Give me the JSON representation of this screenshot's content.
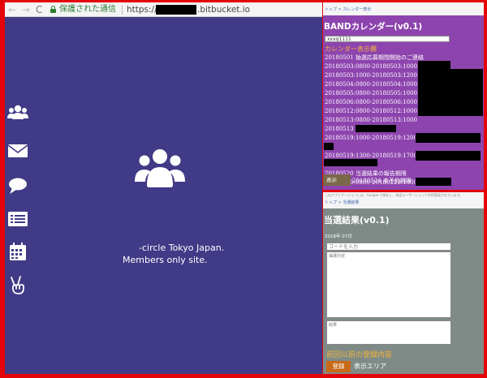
{
  "browser": {
    "back_icon": "←",
    "forward_icon": "→",
    "reload_icon": "C",
    "secure_label": "保護された通信",
    "url_prefix": "https://",
    "url_suffix": ".bitbucket.io"
  },
  "sidebar": {
    "icons": [
      "users-icon",
      "envelope-icon",
      "comment-icon",
      "list-icon",
      "calendar-icon",
      "peace-hand-icon"
    ]
  },
  "brand": {
    "icon": "users-icon",
    "tagline_line1": "-circle Tokyo Japan.",
    "tagline_line2": "Members only site."
  },
  "calendar_panel": {
    "breadcrumb": "トップ > カレンダー表示",
    "title": "BANDカレンダー(v0.1)",
    "input_value": "xxxg1111",
    "section_title": "カレンダー表示欄",
    "rows": [
      "20180501 抽選応募期間開始のご連絡",
      "20180503:0800-20180503:1000",
      "20180503:1000-20180503:1200",
      "20180504:0800-20180504:1000",
      "20180505:0800-20180505:1000",
      "20180506:0800-20180506:1000",
      "20180512:0800-20180512:1000",
      "20180513:0800-20180513:1000",
      "20180513",
      "20180519:1000-20180519:1200",
      "",
      "20180519:1300-20180519:1700",
      "",
      "20180520 当選結果の報告期限",
      "20180520:0800-20180520:1000",
      "20180524 本予約期限",
      "20180526:1200-20180526:1400"
    ],
    "button_label": "表示"
  },
  "result_panel": {
    "top_note": "このアプリケーションには、Google で保存し、承認ユーザーによって利用登録されています。",
    "breadcrumb": "トップ > 当選結果",
    "title": "当選結果(v0.1)",
    "date_label": "2018年 07月",
    "code_placeholder": "コードを入力",
    "draw_label": "抽選内容",
    "result_label": "結果",
    "prev_title": "前回以前の登録内容",
    "register_button": "登録",
    "area_label": "表示エリア"
  },
  "colors": {
    "frame": "#e4050a",
    "left_bg": "#413a86",
    "calendar_bg": "#8d44ae",
    "result_bg": "#7f8b87",
    "accent": "#f3b33a",
    "secure_green": "#2e7d32"
  }
}
